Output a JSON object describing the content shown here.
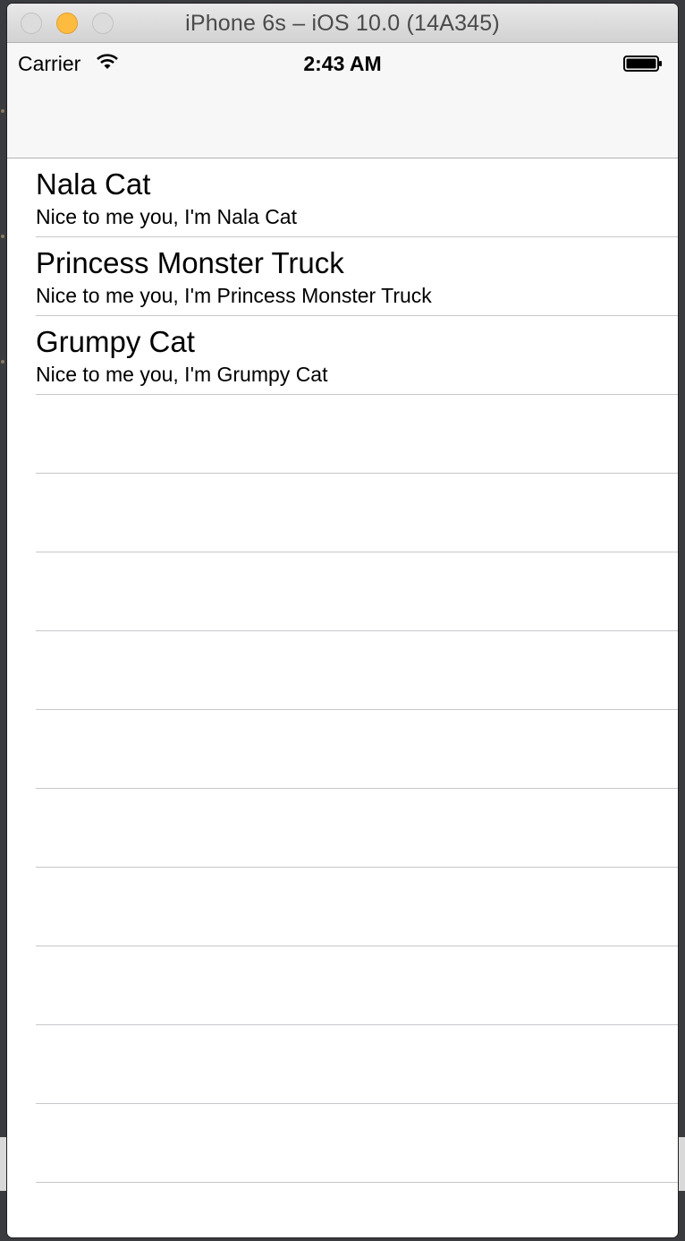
{
  "window": {
    "title": "iPhone 6s – iOS 10.0 (14A345)"
  },
  "status_bar": {
    "carrier": "Carrier",
    "time": "2:43 AM"
  },
  "table": {
    "rows": [
      {
        "title": "Nala Cat",
        "subtitle": "Nice to me you, I'm Nala Cat"
      },
      {
        "title": "Princess Monster Truck",
        "subtitle": "Nice to me you, I'm Princess Monster Truck"
      },
      {
        "title": "Grumpy Cat",
        "subtitle": "Nice to me you, I'm Grumpy Cat"
      }
    ]
  },
  "colors": {
    "minimize_button": "#fdbc40",
    "navbar_bg": "#f7f7f7",
    "separator": "#c8c7cc"
  },
  "icons": [
    "wifi-icon",
    "battery-icon"
  ]
}
